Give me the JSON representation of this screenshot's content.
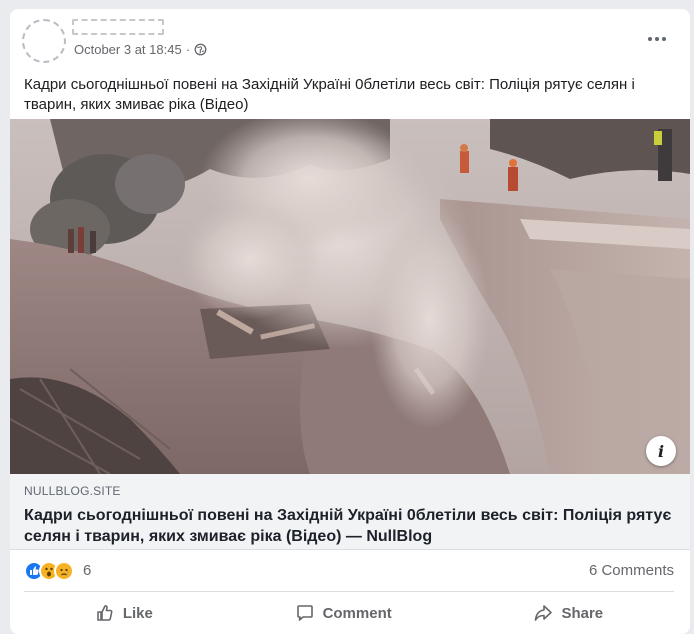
{
  "post": {
    "timestamp": "October 3 at 18:45",
    "separator": "·",
    "privacy_icon": "globe-icon",
    "more_icon": "more-dots-icon",
    "text": "Кадри сьогоднішньої повені на Західній Україні 0блетіли весь світ: Поліція рятує селян і тварин, яких змиває ріка (Відео)"
  },
  "link_preview": {
    "domain": "NULLBLOG.SITE",
    "title": "Кадри сьогоднішньої повені на Західній Україні 0блетіли весь світ: Поліція рятує селян і тварин, яких змиває ріка (Відео) — NullBlog",
    "info_label": "i"
  },
  "stats": {
    "reaction_icons": [
      "like-reaction-icon",
      "wow-reaction-icon",
      "sad-reaction-icon"
    ],
    "reaction_count": "6",
    "comments": "6 Comments"
  },
  "actions": {
    "like": "Like",
    "comment": "Comment",
    "share": "Share"
  },
  "colors": {
    "brand_blue": "#1877f2",
    "reaction_yellow": "#f7b125",
    "secondary_text": "#65676b"
  }
}
